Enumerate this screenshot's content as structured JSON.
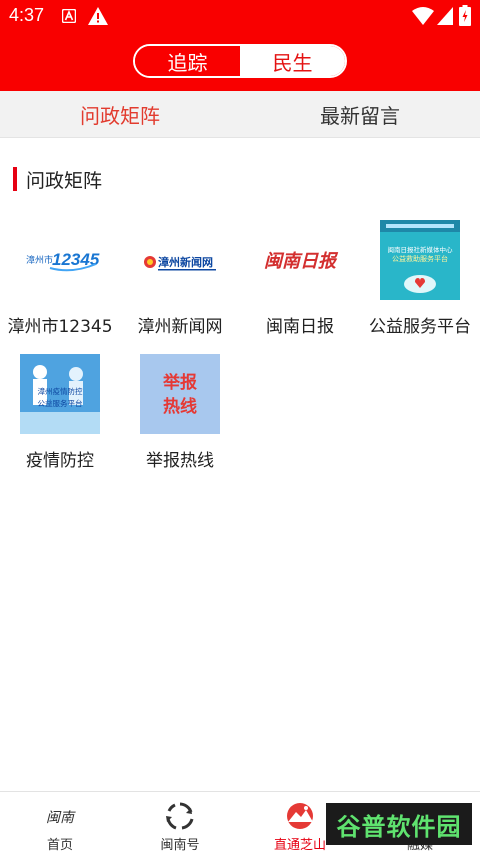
{
  "status": {
    "time": "4:37"
  },
  "header": {
    "segments": [
      {
        "label": "追踪",
        "active": true
      },
      {
        "label": "民生",
        "active": false
      }
    ]
  },
  "tabs": [
    {
      "label": "问政矩阵",
      "active": true
    },
    {
      "label": "最新留言",
      "active": false
    }
  ],
  "section": {
    "title": "问政矩阵"
  },
  "items": [
    {
      "label": "漳州市12345",
      "logo_text": "漳州市12345"
    },
    {
      "label": "漳州新闻网",
      "logo_text": "漳州新闻网"
    },
    {
      "label": "闽南日报",
      "logo_text": "闽南日报"
    },
    {
      "label": "公益服务平台",
      "logo_text": "闽南日报社新媒体中心 公益救助服务平台"
    },
    {
      "label": "疫情防控",
      "logo_text": "漳州疫情防控 公益服务平台"
    },
    {
      "label": "举报热线",
      "logo_text": "举报热线"
    }
  ],
  "bottom_nav": [
    {
      "label": "首页",
      "icon": "minnan-logo-icon",
      "active": false
    },
    {
      "label": "闽南号",
      "icon": "cycle-icon",
      "active": false
    },
    {
      "label": "直通芝山",
      "icon": "mountain-icon",
      "active": true
    },
    {
      "label": "融媒",
      "icon": "media-icon",
      "active": false
    }
  ],
  "watermark": "谷普软件园",
  "colors": {
    "brand_red": "#f90000",
    "accent_red": "#e60012"
  }
}
